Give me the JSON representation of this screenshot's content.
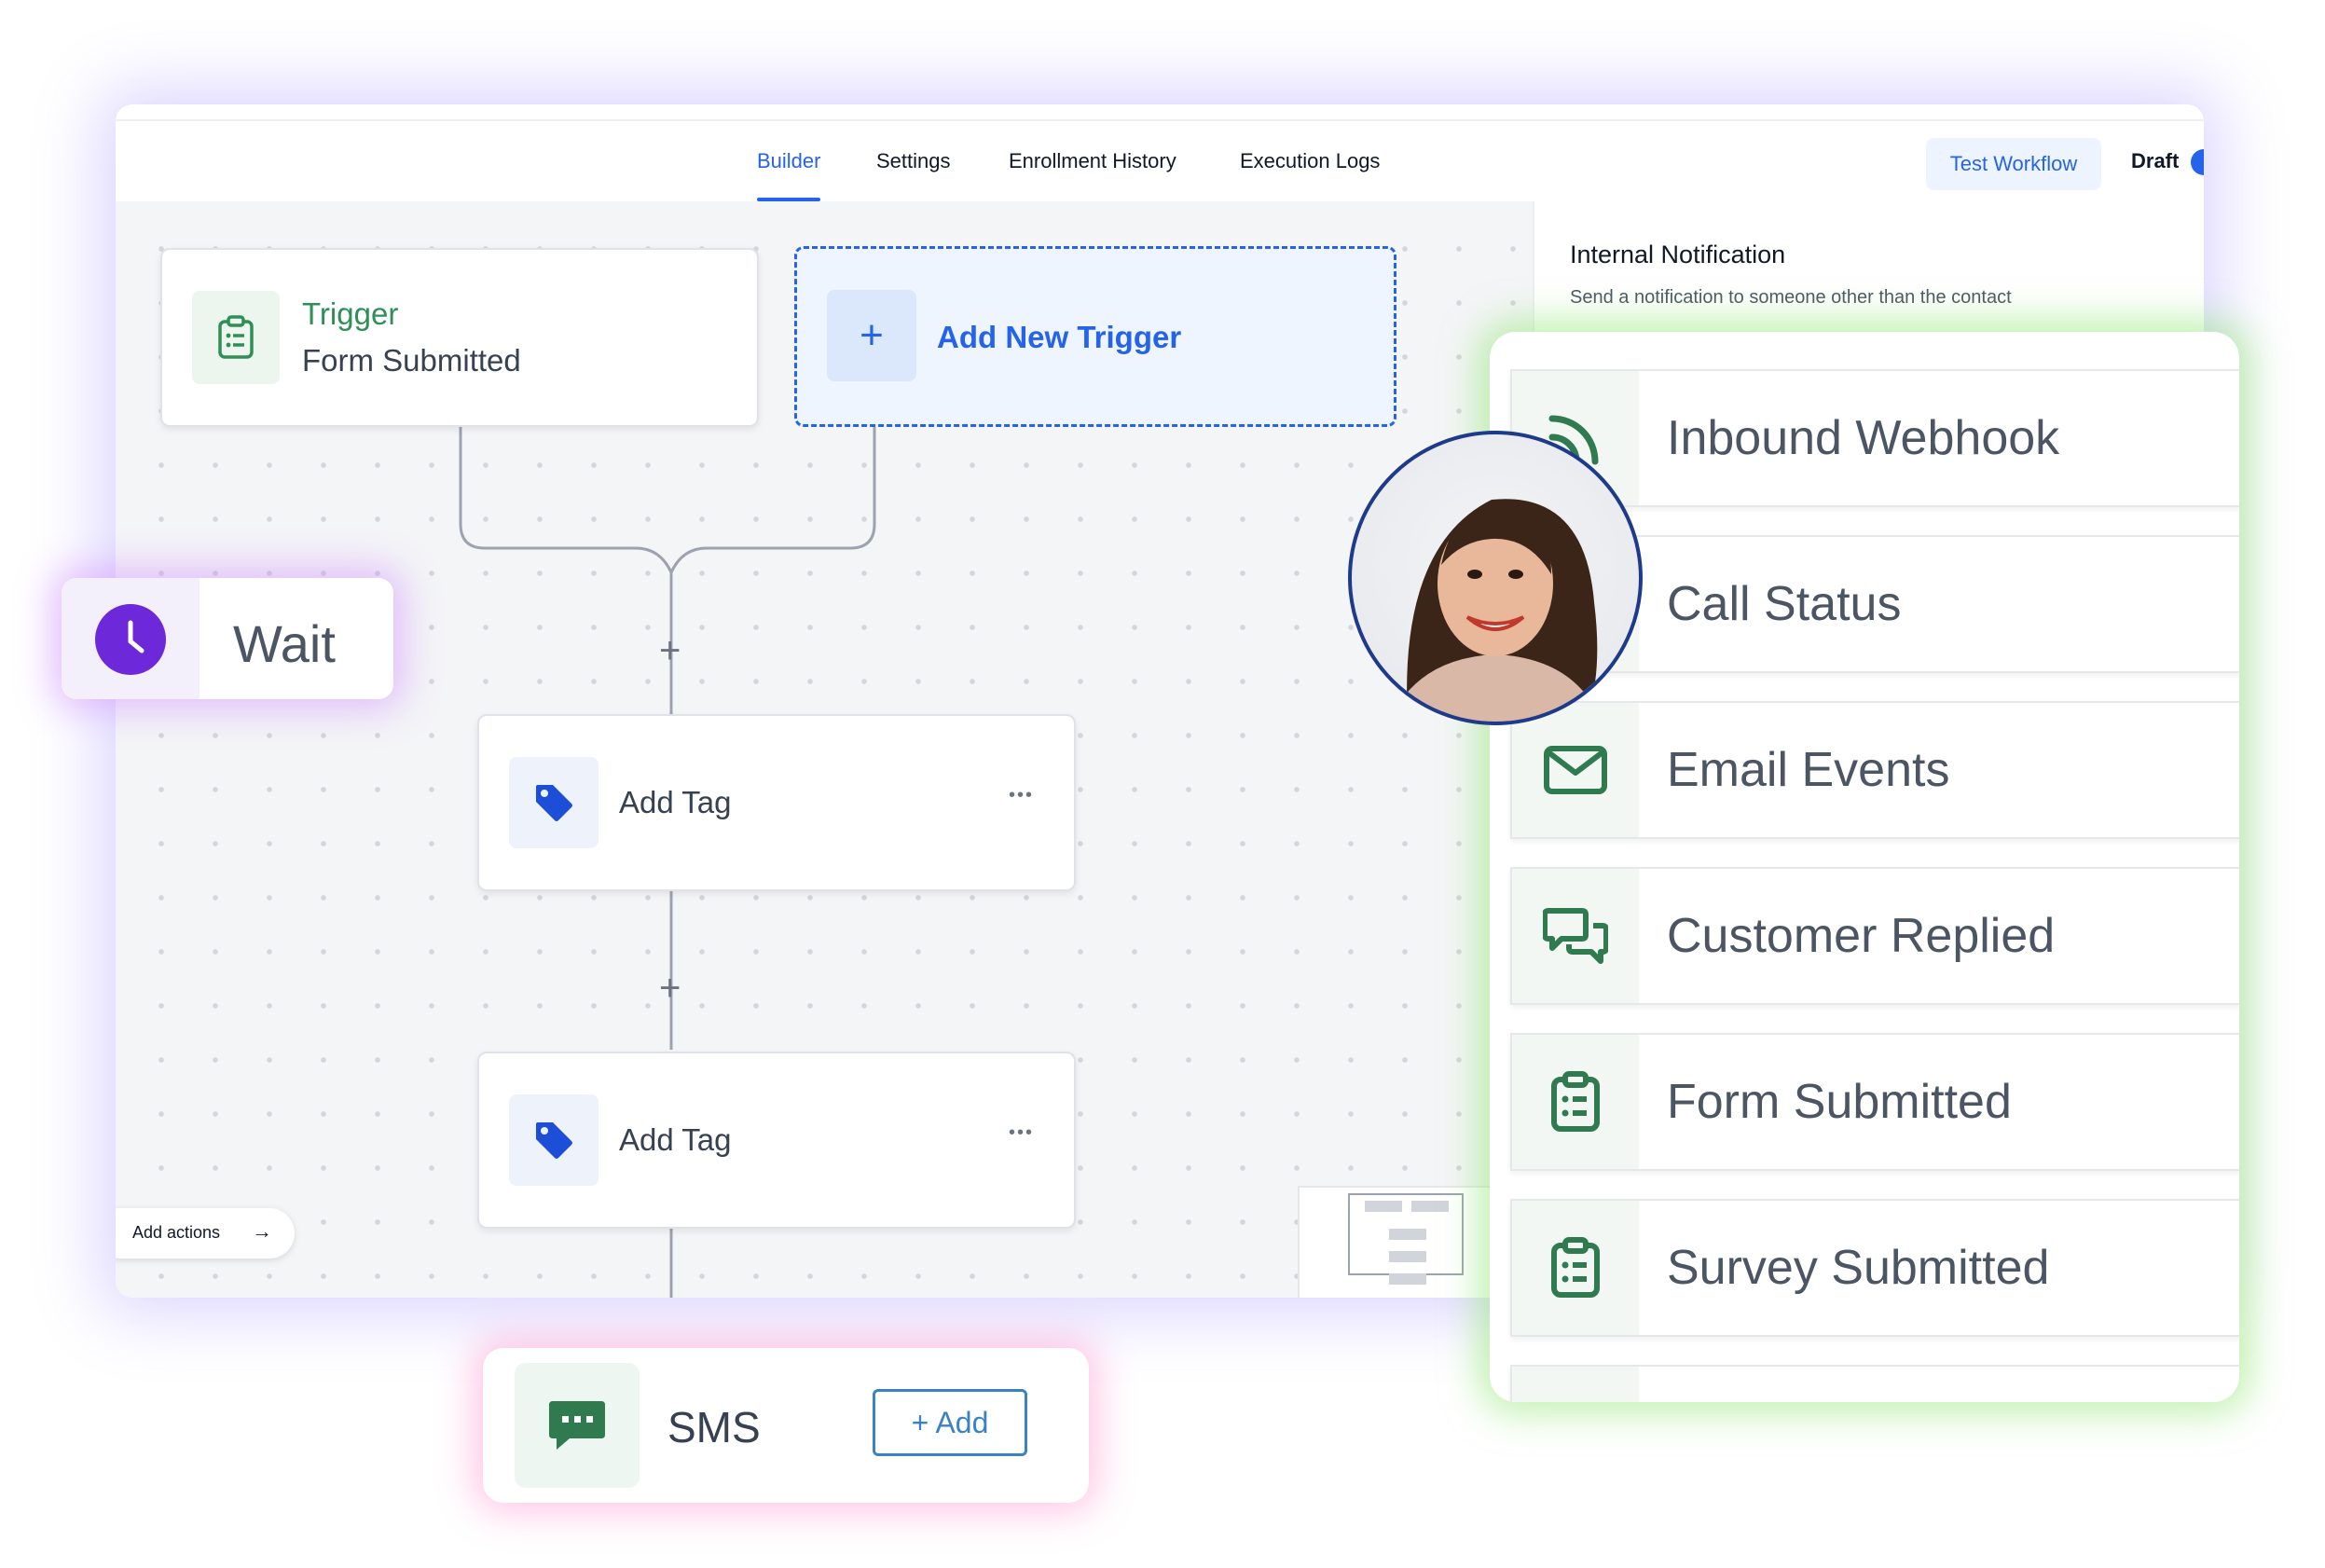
{
  "tabs": [
    "Builder",
    "Settings",
    "Enrollment History",
    "Execution Logs"
  ],
  "test_workflow_label": "Test Workflow",
  "draft_label": "Draft",
  "side_panel": {
    "title": "Internal Notification",
    "description": "Send a notification to someone other than the contact"
  },
  "trigger_node": {
    "title": "Trigger",
    "subtitle": "Form Submitted"
  },
  "add_trigger_label": "Add New Trigger",
  "action_nodes": [
    {
      "label": "Add Tag",
      "menu": "•••"
    },
    {
      "label": "Add Tag",
      "menu": "•••"
    }
  ],
  "plus_glyph": "+",
  "add_actions_label": "Add actions",
  "wait_label": "Wait",
  "sms": {
    "label": "SMS",
    "button": "+ Add"
  },
  "trigger_list": [
    {
      "label": "Inbound Webhook",
      "icon": "webhook-icon"
    },
    {
      "label": "Call Status",
      "icon": "phone-icon"
    },
    {
      "label": "Email Events",
      "icon": "envelope-icon"
    },
    {
      "label": "Customer Replied",
      "icon": "chat-icon"
    },
    {
      "label": "Form Submitted",
      "icon": "clipboard-icon"
    },
    {
      "label": "Survey Submitted",
      "icon": "clipboard-icon"
    }
  ],
  "colors": {
    "accent_blue": "#2563eb",
    "trigger_green": "#2f8f57",
    "wait_purple": "#6d28d9",
    "sms_green": "#2f7a4f"
  }
}
